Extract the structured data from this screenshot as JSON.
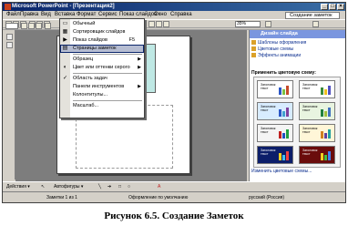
{
  "window": {
    "title": "Microsoft PowerPoint - [Презентация2]"
  },
  "menubar": [
    "Файл",
    "Правка",
    "Вид",
    "Вставка",
    "Формат",
    "Сервис",
    "Показ слайдов",
    "Окно",
    "Справка"
  ],
  "toolbar": {
    "zoom": "35%",
    "help_box": "Создание заметок"
  },
  "view_menu": {
    "items": [
      {
        "label": "Обычный",
        "key": "",
        "submenu": false
      },
      {
        "label": "Сортировщик слайдов",
        "key": "",
        "submenu": false
      },
      {
        "label": "Показ слайдов",
        "key": "F5",
        "submenu": false
      },
      {
        "label": "Страницы заметок",
        "key": "",
        "submenu": false,
        "highlighted": true
      },
      {
        "label": "Образец",
        "key": "",
        "submenu": true
      },
      {
        "label": "Цвет или оттенки серого",
        "key": "",
        "submenu": true
      },
      {
        "label": "Область задач",
        "key": "",
        "submenu": false,
        "checked": true
      },
      {
        "label": "Панели инструментов",
        "key": "",
        "submenu": true
      },
      {
        "label": "Колонтитулы...",
        "key": "",
        "submenu": false
      },
      {
        "label": "Масштаб...",
        "key": "",
        "submenu": false
      }
    ]
  },
  "task_pane": {
    "title": "Дизайн слайда",
    "links": [
      "Шаблоны оформления",
      "Цветовые схемы",
      "Эффекты анимации"
    ],
    "section_label": "Применить цветовую схему:",
    "scheme_title": "Заголовок текст",
    "change_link": "Изменить цветовые схемы..."
  },
  "drawing_toolbar": {
    "actions": "Действия ▾",
    "autoshapes": "Автофигуры ▾"
  },
  "status": {
    "slide": "Заметки 1 из 1",
    "design": "Оформление по умолчанию",
    "language": "русский (Россия)"
  },
  "caption": "Рисунок 6.5. Создание Заметок",
  "colors": {
    "title_bar": "#0a246a",
    "task_pane_header": "#7a96df",
    "slide_fill": "#bfe8e4",
    "menu_highlight": "#b6bdd2"
  }
}
